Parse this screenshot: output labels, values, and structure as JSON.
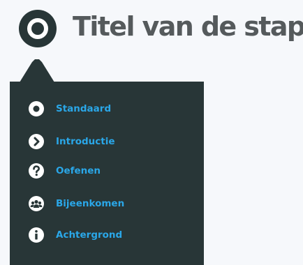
{
  "header": {
    "title": "Titel van de stap",
    "icon": "step-type-icon"
  },
  "menu": {
    "items": [
      {
        "label": "Standaard",
        "icon": "standard-circle-icon"
      },
      {
        "label": "Introductie",
        "icon": "introduction-arrow-icon"
      },
      {
        "label": "Oefenen",
        "icon": "practice-question-icon"
      },
      {
        "label": "Bijeenkomen",
        "icon": "meeting-group-icon"
      },
      {
        "label": "Achtergrond",
        "icon": "background-info-icon"
      }
    ]
  },
  "colors": {
    "background": "#f6f8fb",
    "panel": "#283637",
    "title": "#555a5c",
    "accent": "#2aa7e8",
    "icon_fill": "#ffffff"
  }
}
